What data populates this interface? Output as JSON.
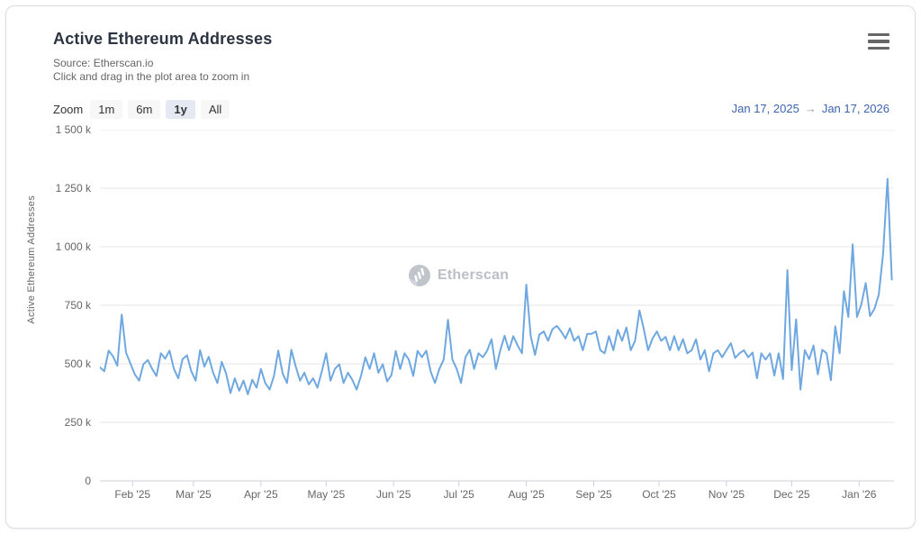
{
  "header": {
    "title": "Active Ethereum Addresses",
    "subtitle_source": "Source: Etherscan.io",
    "subtitle_hint": "Click and drag in the plot area to zoom in"
  },
  "toolbar": {
    "zoom_label": "Zoom",
    "buttons": [
      {
        "label": "1m",
        "selected": false
      },
      {
        "label": "6m",
        "selected": false
      },
      {
        "label": "1y",
        "selected": true
      },
      {
        "label": "All",
        "selected": false
      }
    ],
    "range": {
      "start": "Jan 17, 2025",
      "arrow": "→",
      "end": "Jan 17, 2026"
    }
  },
  "watermark": {
    "text": "Etherscan"
  },
  "colors": {
    "line": "#6fa8e0",
    "grid": "#e6e6e6",
    "axis": "#ccd1d9",
    "accent_blue": "#3d64ad",
    "label_gray": "#666666"
  },
  "chart_data": {
    "type": "line",
    "title": "Active Ethereum Addresses",
    "ylabel": "Active Ethereum Addresses",
    "xlabel": "",
    "grid": true,
    "legend": "none",
    "ylim": [
      0,
      1500
    ],
    "values_unit": "thousands of addresses",
    "x_span_days": 365,
    "x_start": "Jan 17, 2025",
    "x_end": "Jan 17, 2026",
    "sample_step_days": 2,
    "yticks": [
      {
        "label": "1 500 k",
        "value": 1500
      },
      {
        "label": "1 250 k",
        "value": 1250
      },
      {
        "label": "1 000 k",
        "value": 1000
      },
      {
        "label": "750 k",
        "value": 750
      },
      {
        "label": "500 k",
        "value": 500
      },
      {
        "label": "250 k",
        "value": 250
      },
      {
        "label": "0",
        "value": 0
      }
    ],
    "months": [
      {
        "label": "Feb '25",
        "day": 15
      },
      {
        "label": "Mar '25",
        "day": 43
      },
      {
        "label": "Apr '25",
        "day": 74
      },
      {
        "label": "May '25",
        "day": 104
      },
      {
        "label": "Jun '25",
        "day": 135
      },
      {
        "label": "Jul '25",
        "day": 165
      },
      {
        "label": "Aug '25",
        "day": 196
      },
      {
        "label": "Sep '25",
        "day": 227
      },
      {
        "label": "Oct '25",
        "day": 257
      },
      {
        "label": "Nov '25",
        "day": 288
      },
      {
        "label": "Dec '25",
        "day": 318
      },
      {
        "label": "Jan '26",
        "day": 349
      }
    ],
    "values": [
      485,
      468,
      556,
      532,
      492,
      710,
      548,
      502,
      455,
      428,
      498,
      516,
      478,
      448,
      545,
      522,
      556,
      478,
      438,
      520,
      536,
      468,
      428,
      558,
      488,
      530,
      462,
      418,
      508,
      458,
      375,
      438,
      385,
      428,
      370,
      432,
      398,
      478,
      418,
      390,
      448,
      556,
      458,
      418,
      560,
      488,
      428,
      462,
      412,
      438,
      398,
      468,
      545,
      428,
      478,
      498,
      418,
      462,
      432,
      390,
      448,
      528,
      478,
      545,
      462,
      498,
      425,
      452,
      555,
      478,
      545,
      518,
      448,
      555,
      528,
      556,
      468,
      418,
      478,
      518,
      688,
      518,
      478,
      418,
      528,
      560,
      478,
      545,
      528,
      556,
      605,
      478,
      556,
      620,
      558,
      618,
      578,
      545,
      838,
      618,
      538,
      625,
      638,
      598,
      648,
      662,
      638,
      608,
      652,
      598,
      618,
      558,
      628,
      628,
      638,
      558,
      545,
      618,
      558,
      645,
      598,
      655,
      558,
      598,
      728,
      648,
      558,
      608,
      638,
      598,
      615,
      558,
      618,
      558,
      605,
      545,
      558,
      605,
      518,
      558,
      468,
      545,
      558,
      528,
      558,
      588,
      525,
      545,
      558,
      528,
      548,
      438,
      545,
      518,
      545,
      450,
      545,
      435,
      900,
      473,
      690,
      390,
      558,
      520,
      578,
      455,
      560,
      545,
      430,
      660,
      545,
      810,
      700,
      1010,
      700,
      755,
      845,
      704,
      735,
      795,
      970,
      1290,
      860
    ]
  }
}
